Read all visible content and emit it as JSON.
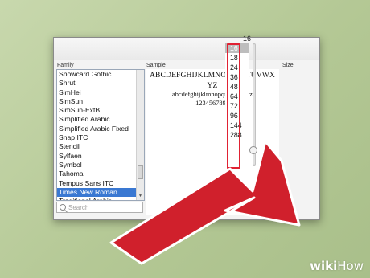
{
  "colors": {
    "background": "#b9cc9c",
    "selection": "#3a78d2",
    "highlight_border": "#e02233",
    "arrow_fill": "#d0202c"
  },
  "family_panel": {
    "label": "Family",
    "items": [
      "Showcard Gothic",
      "Shruti",
      "SimHei",
      "SimSun",
      "SimSun-ExtB",
      "Simplified Arabic",
      "Simplified Arabic Fixed",
      "Snap ITC",
      "Stencil",
      "Sylfaen",
      "Symbol",
      "Tahoma",
      "Tempus Sans ITC",
      "Times New Roman",
      "Traditional Arabic"
    ],
    "selected": "Times New Roman"
  },
  "search": {
    "placeholder": "Search"
  },
  "sample_panel": {
    "label": "Sample",
    "line1": "ABCDEFGHIJKLMNOPQRSTUVWX",
    "line2": "YZ",
    "line3": "abcdefghijklmnopqrstuvwxyz",
    "line4": "1234567890"
  },
  "size_panel": {
    "label": "Size",
    "current_value": "16",
    "items": [
      "16",
      "18",
      "24",
      "36",
      "48",
      "64",
      "72",
      "96",
      "144",
      "288"
    ],
    "selected": "16"
  },
  "watermark": {
    "wiki": "wiki",
    "how": "How"
  }
}
